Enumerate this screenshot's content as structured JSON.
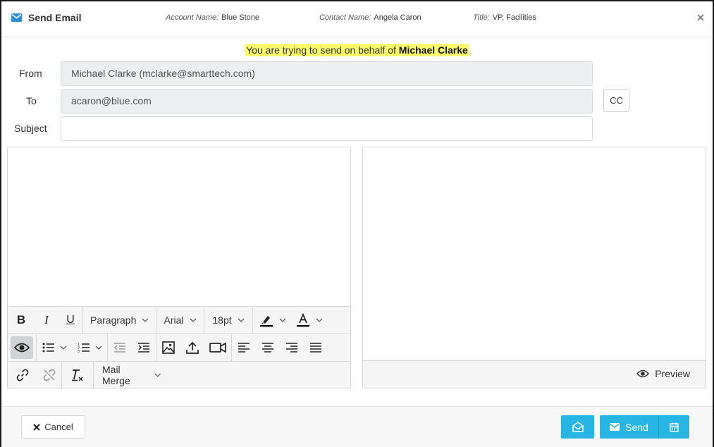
{
  "header": {
    "title": "Send Email",
    "account_key": "Account Name:",
    "account_value": "Blue Stone",
    "contact_key": "Contact Name:",
    "contact_value": "Angela Caron",
    "title_key": "Title:",
    "title_value": "VP, Facilities",
    "close_glyph": "×"
  },
  "behalf": {
    "prefix": "You are trying to send on behalf of ",
    "name": "Michael Clarke"
  },
  "form": {
    "from_label": "From",
    "from_value": "Michael Clarke (mclarke@smarttech.com)",
    "to_label": "To",
    "to_value": "acaron@blue.com",
    "cc_label": "CC",
    "subject_label": "Subject",
    "subject_value": ""
  },
  "toolbar": {
    "bold": "B",
    "italic": "I",
    "underline": "U",
    "paragraph": "Paragraph",
    "font": "Arial",
    "size": "18pt",
    "mail_merge": "Mail Merge"
  },
  "preview": {
    "label": "Preview"
  },
  "footer": {
    "cancel_label": "Cancel",
    "send_label": "Send"
  },
  "colors": {
    "accent": "#27b6e3",
    "highlight": "#fafa6a",
    "email_icon": "#2d8fd5"
  },
  "icons": [
    "envelope-icon",
    "close-icon",
    "eye-icon",
    "bullet-list-icon",
    "numbered-list-icon",
    "outdent-icon",
    "indent-icon",
    "image-icon",
    "upload-icon",
    "video-icon",
    "align-left-icon",
    "align-center-icon",
    "align-right-icon",
    "justify-icon",
    "link-icon",
    "unlink-icon",
    "clear-format-icon",
    "highlighter-icon",
    "font-color-icon",
    "envelope-open-icon",
    "calendar-icon"
  ]
}
